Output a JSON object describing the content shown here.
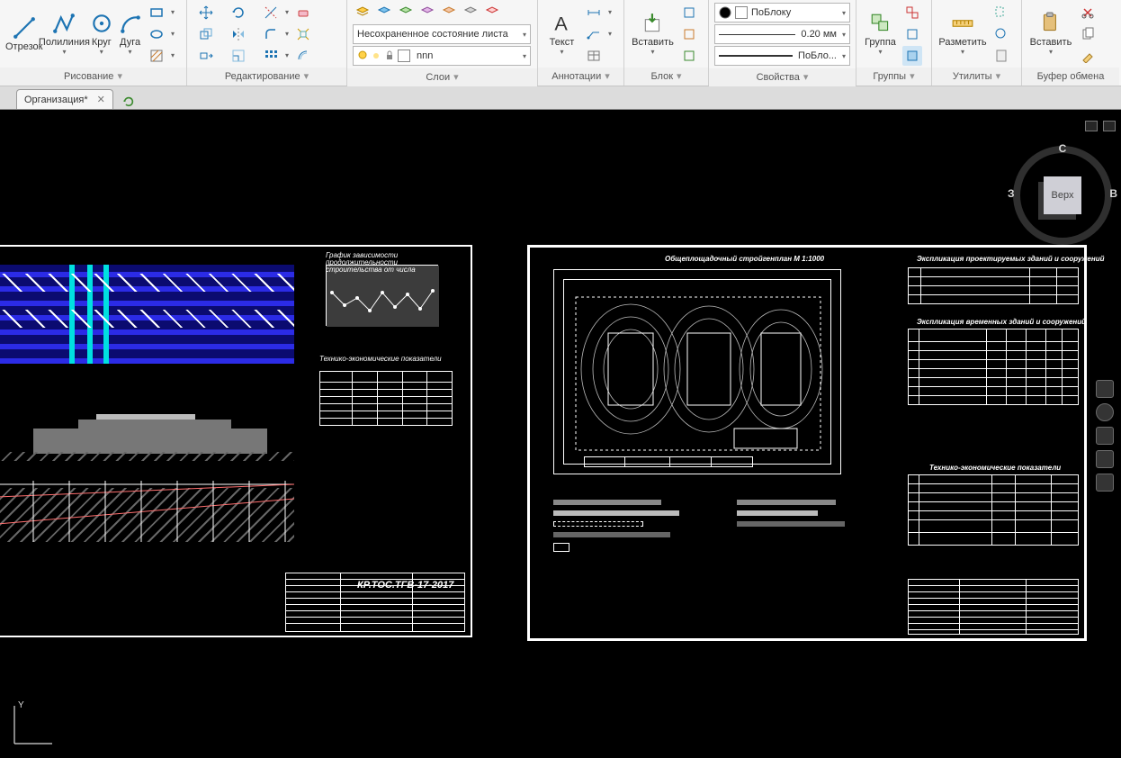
{
  "ribbon": {
    "draw": {
      "title": "Рисование",
      "line": "Отрезок",
      "polyline": "Полилиния",
      "circle": "Круг",
      "arc": "Дуга"
    },
    "edit": {
      "title": "Редактирование"
    },
    "layers": {
      "title": "Слои",
      "state": "Несохраненное состояние листа",
      "current": "nnn"
    },
    "annot": {
      "title": "Аннотации",
      "text": "Текст"
    },
    "block": {
      "title": "Блок",
      "insert": "Вставить"
    },
    "props": {
      "title": "Свойства",
      "color": "ПоБлоку",
      "lineweight": "0.20 мм",
      "linetype": "ПоБло..."
    },
    "groups": {
      "title": "Группы",
      "group": "Группа"
    },
    "utils": {
      "title": "Утилиты",
      "measure": "Разметить"
    },
    "clipboard": {
      "title": "Буфер обмена",
      "paste": "Вставить"
    }
  },
  "tab": {
    "name": "Организация*"
  },
  "viewcube": {
    "top": "Верх",
    "n": "С",
    "w": "З",
    "e": "В"
  },
  "drawing1": {
    "chart_title": "График зависимости продолжительности строительства от числа",
    "tep_title": "Технико-экономические показатели",
    "code": "КР.ТОС.ТГВ-17-2017"
  },
  "drawing2": {
    "plan_title": "Общеплощадочный стройгенплан М 1:1000",
    "expl1_title": "Экспликация проектируемых зданий и сооружений",
    "expl2_title": "Экспликация временных зданий и сооружений",
    "tep_title": "Технико-экономические показатели"
  }
}
